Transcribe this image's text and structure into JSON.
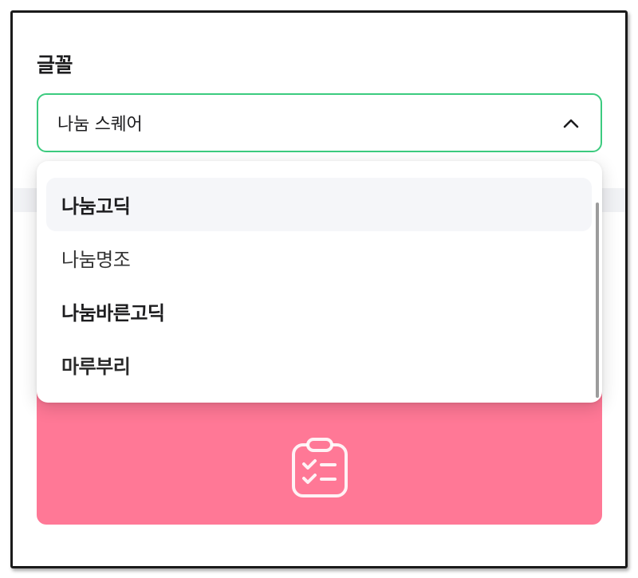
{
  "font_setting": {
    "label": "글꼴",
    "selected_value": "나눔 스퀘어",
    "expanded": true,
    "accent_color": "#3ccb7f"
  },
  "dropdown": {
    "options": [
      {
        "label": "나눔고딕",
        "hovered": true
      },
      {
        "label": "나눔명조",
        "hovered": false
      },
      {
        "label": "나눔바른고딕",
        "hovered": false
      },
      {
        "label": "마루부리",
        "hovered": false
      }
    ]
  },
  "preview_card": {
    "background_color": "#ff7896",
    "icon": "clipboard-checklist-icon"
  },
  "icons": {
    "select_toggle": "chevron-up-icon"
  }
}
